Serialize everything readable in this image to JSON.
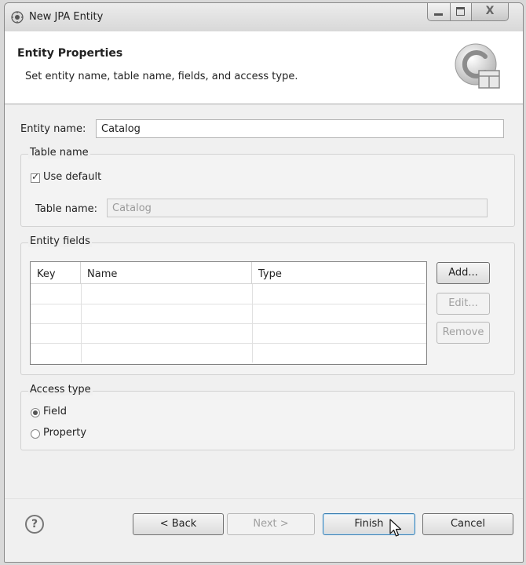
{
  "window": {
    "title": "New JPA Entity"
  },
  "header": {
    "title": "Entity Properties",
    "description": "Set entity name, table name, fields, and access type.",
    "icon": "jpa-entity-wizard-icon"
  },
  "entity": {
    "name_label": "Entity name:",
    "name_value": "Catalog"
  },
  "table_group": {
    "legend": "Table name",
    "use_default_label": "Use default",
    "use_default_checked": true,
    "table_name_label": "Table name:",
    "table_name_value": "Catalog"
  },
  "fields_group": {
    "legend": "Entity fields",
    "columns": [
      "Key",
      "Name",
      "Type"
    ],
    "rows": [],
    "buttons": {
      "add": "Add...",
      "edit": "Edit...",
      "remove": "Remove"
    }
  },
  "access_group": {
    "legend": "Access type",
    "options": [
      "Field",
      "Property"
    ],
    "selected": "Field"
  },
  "footer": {
    "help_icon": "help-icon",
    "back": "< Back",
    "next": "Next >",
    "finish": "Finish",
    "cancel": "Cancel"
  },
  "colors": {
    "background": "#f0f0f0",
    "header_background": "#ffffff",
    "default_button_border": "#3c7fb1"
  }
}
